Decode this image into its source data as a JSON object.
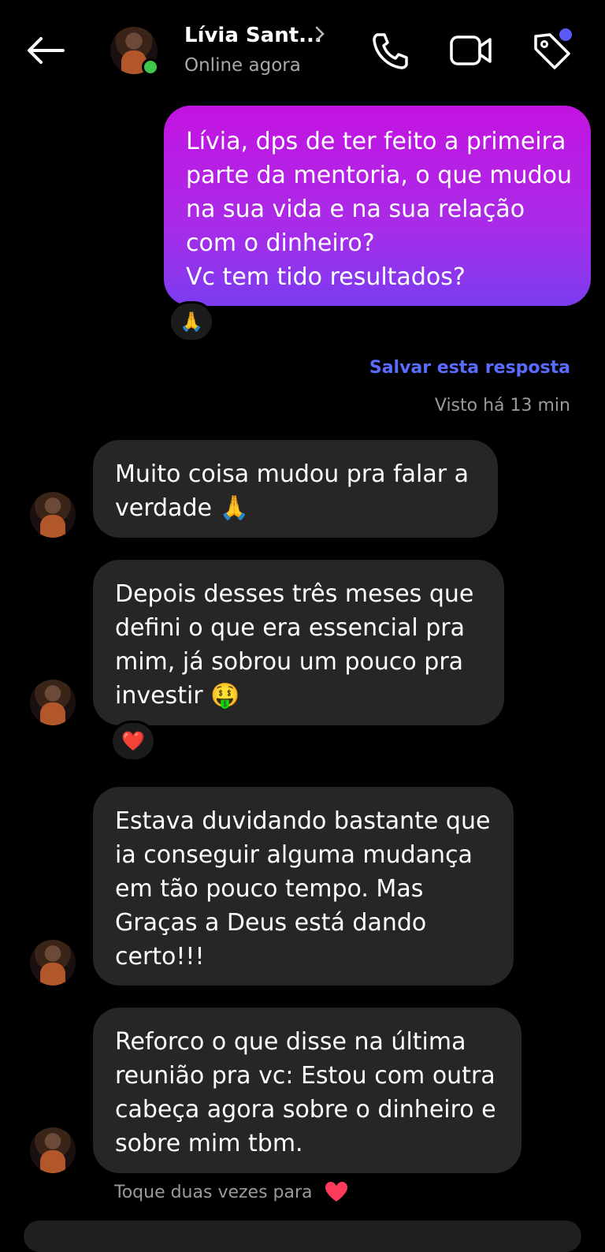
{
  "header": {
    "contact_name": "Lívia Sant...",
    "status": "Online agora",
    "icons": [
      "back-arrow-icon",
      "chevron-right-icon",
      "phone-icon",
      "video-icon",
      "tag-icon"
    ]
  },
  "messages": [
    {
      "from": "me",
      "text": "Lívia, dps de ter feito a primeira\nparte da mentoria, o que mudou\nna sua vida e na sua relação\ncom o dinheiro?\nVc tem tido resultados?",
      "reaction": "🙏"
    },
    {
      "from": "contact",
      "text": "Muito coisa mudou pra falar a\nverdade 🙏"
    },
    {
      "from": "contact",
      "text": "Depois desses três meses que\ndefini o que era essencial pra\nmim, já sobrou um pouco pra\ninvestir 🤑",
      "reaction": "❤️"
    },
    {
      "from": "contact",
      "text": "Estava duvidando bastante que\nia conseguir alguma mudança\nem tão pouco tempo. Mas\nGraças a Deus está dando\ncerto!!!"
    },
    {
      "from": "contact",
      "text": "Reforco o que disse na última\nreunião pra vc: Estou com outra\ncabeça agora sobre o dinheiro e\nsobre mim tbm."
    }
  ],
  "save_reply_label": "Salvar esta resposta",
  "seen_label": "Visto há 13 min",
  "double_tap_hint": "Toque duas vezes para",
  "colors": {
    "sent_bubble_top": "#c313e0",
    "sent_bubble_bottom": "#7b3cf0",
    "received_bubble": "#262626",
    "link": "#5a6bff",
    "online": "#3ec74a"
  }
}
